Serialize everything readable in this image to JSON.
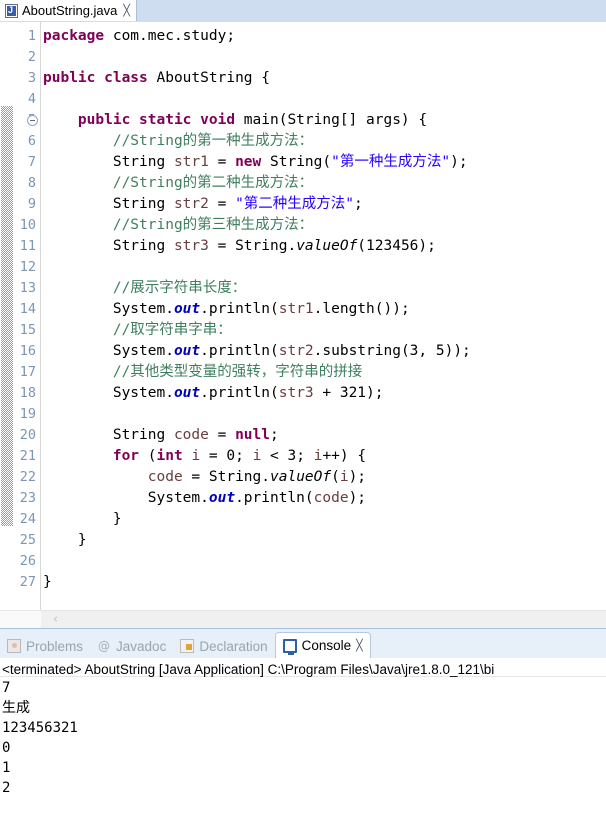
{
  "editor": {
    "tab": {
      "icon": "java-file-icon",
      "label": "AboutString.java",
      "close": "╳"
    },
    "current_line": 23,
    "lines": [
      {
        "num": "1",
        "html": "<span class='kw'>package</span> com.mec.study;"
      },
      {
        "num": "2",
        "html": ""
      },
      {
        "num": "3",
        "html": "<span class='kw'>public class</span> AboutString {"
      },
      {
        "num": "4",
        "html": ""
      },
      {
        "num": "5",
        "html": "    <span class='kw'>public static void</span> main(String[] args) {",
        "fold": true
      },
      {
        "num": "6",
        "html": "        <span class='cmt'>//String的第一种生成方法：</span>"
      },
      {
        "num": "7",
        "html": "        String <span class='lvar'>str1</span> = <span class='kw'>new</span> String(<span class='str'>\"第一种生成方法\"</span>);"
      },
      {
        "num": "8",
        "html": "        <span class='cmt'>//String的第二种生成方法：</span>"
      },
      {
        "num": "9",
        "html": "        String <span class='lvar'>str2</span> = <span class='str'>\"第二种生成方法\"</span>;"
      },
      {
        "num": "10",
        "html": "        <span class='cmt'>//String的第三种生成方法：</span>"
      },
      {
        "num": "11",
        "html": "        String <span class='lvar'>str3</span> = String.<span class='mth'>valueOf</span>(123456);"
      },
      {
        "num": "12",
        "html": ""
      },
      {
        "num": "13",
        "html": "        <span class='cmt'>//展示字符串长度：</span>"
      },
      {
        "num": "14",
        "html": "        System.<span class='fld'>out</span>.println(<span class='lvar'>str1</span>.length());"
      },
      {
        "num": "15",
        "html": "        <span class='cmt'>//取字符串字串：</span>"
      },
      {
        "num": "16",
        "html": "        System.<span class='fld'>out</span>.println(<span class='lvar'>str2</span>.substring(3, 5));"
      },
      {
        "num": "17",
        "html": "        <span class='cmt'>//其他类型变量的强转，字符串的拼接</span>"
      },
      {
        "num": "18",
        "html": "        System.<span class='fld'>out</span>.println(<span class='lvar'>str3</span> + 321);"
      },
      {
        "num": "19",
        "html": ""
      },
      {
        "num": "20",
        "html": "        String <span class='lvar'>code</span> = <span class='kw'>null</span>;"
      },
      {
        "num": "21",
        "html": "        <span class='kw'>for</span> (<span class='kw'>int</span> <span class='lvar'>i</span> = 0; <span class='lvar'>i</span> &lt; 3; <span class='lvar'>i</span>++) {"
      },
      {
        "num": "22",
        "html": "            <span class='lvar'>code</span> = String.<span class='mth'>valueOf</span>(<span class='lvar'>i</span>);"
      },
      {
        "num": "23",
        "html": "            System.<span class='fld'>out</span>.println(<span class='lvar'>code</span>);"
      },
      {
        "num": "24",
        "html": "        }"
      },
      {
        "num": "25",
        "html": "    }"
      },
      {
        "num": "26",
        "html": ""
      },
      {
        "num": "27",
        "html": "}"
      }
    ],
    "scrollbar": {
      "left_arrow": "‹"
    }
  },
  "bottom_panel": {
    "tabs": [
      {
        "label": "Problems",
        "icon": "problems-icon",
        "active": false
      },
      {
        "label": "Javadoc",
        "icon": "javadoc-at-icon",
        "active": false
      },
      {
        "label": "Declaration",
        "icon": "declaration-icon",
        "active": false
      },
      {
        "label": "Console",
        "icon": "console-icon",
        "active": true,
        "close": "╳"
      }
    ],
    "console": {
      "header": "<terminated> AboutString [Java Application] C:\\Program Files\\Java\\jre1.8.0_121\\bi",
      "output": [
        "7",
        "生成",
        "123456321",
        "0",
        "1",
        "2"
      ]
    }
  },
  "colors": {
    "keyword": "#7F0055",
    "string": "#2A00FF",
    "comment": "#3F7F5F",
    "field": "#0000C0",
    "local_var": "#6A3E3E",
    "tabbar_bg": "#CEDDEF",
    "panel_bg": "#E7EFF8",
    "current_line_hl": "#EAF2FB"
  }
}
